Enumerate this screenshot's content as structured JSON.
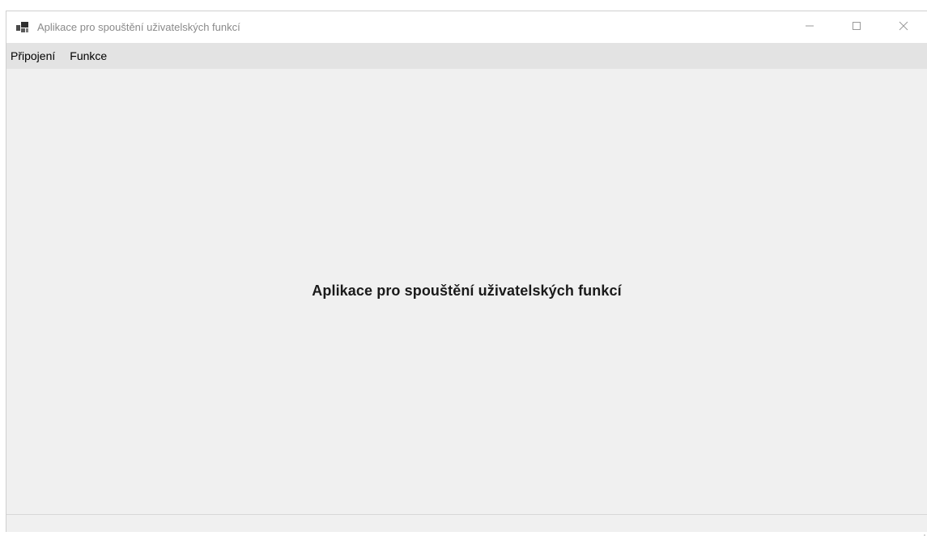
{
  "window": {
    "title": "Aplikace pro spouštění uživatelských funkcí",
    "icon": "app-window-icon",
    "controls": {
      "minimize": "minimize-icon",
      "maximize": "maximize-icon",
      "close": "close-icon"
    }
  },
  "menubar": {
    "items": [
      {
        "label": "Připojení"
      },
      {
        "label": "Funkce"
      }
    ]
  },
  "main": {
    "heading": "Aplikace pro spouštění uživatelských funkcí"
  },
  "colors": {
    "window_background": "#f0f0f0",
    "menubar_background": "#e3e3e3",
    "titlebar_background": "#ffffff"
  }
}
